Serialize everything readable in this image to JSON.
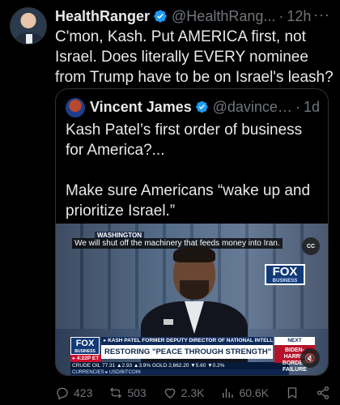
{
  "tweet": {
    "author_name": "HealthRanger",
    "author_handle": "@HealthRang...",
    "separator": "·",
    "time": "12h",
    "more": "···",
    "text": "C'mon, Kash. Put AMERICA first, not Israel. Does literally EVERY nominee from Trump have to be on Israel's leash?"
  },
  "quote": {
    "author_name": "Vincent James",
    "author_handle": "@davincen...",
    "separator": "·",
    "time": "1d",
    "paragraph1": "Kash Patel’s first order of business for America?...",
    "paragraph2": "Make sure Americans “wake up and prioritize Israel.”"
  },
  "video": {
    "location_label": "WASHINGTON",
    "caption": "We will shut off the machinery that feeds money into Iran.",
    "cc_label": "CC",
    "logo_text": "FOX",
    "logo_sub": "BUSINESS",
    "name_bar": "▸ KASH PATEL  FORMER DEPUTY DIRECTOR OF NATIONAL INTELLIGENCE",
    "headline": "RESTORING \"PEACE THROUGH STRENGTH\" FOREIGN POLICY",
    "time_chip": "▸ 4:22P ET",
    "ticker": "CRUDE OIL   77.31  ▲2.93  ▲3.9%  GOLD   2,662.20  ▼5.60  ▼0.2%",
    "ticker_sub": "CURRENCIES ▸                                                    USD/BITCOIN",
    "next_label": "NEXT",
    "next_promo": "BIDEN-HARRIS BORDER FAILURE",
    "mute_icon": "speaker-muted-icon"
  },
  "actions": {
    "replies": "423",
    "reposts": "503",
    "likes": "2.3K",
    "views": "60.6K"
  },
  "colors": {
    "background": "#000000",
    "text": "#e7e9ea",
    "muted": "#71767b",
    "verified": "#1d9bf0",
    "border": "#2f3336"
  }
}
